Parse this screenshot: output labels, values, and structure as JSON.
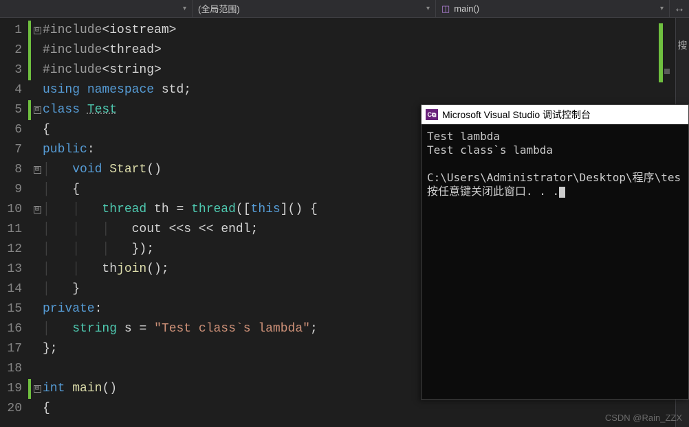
{
  "toolbar": {
    "dd1_label": "",
    "dd2_label": "(全局范围)",
    "dd3_label": "main()",
    "chevron": "▾",
    "split_icon": "↔"
  },
  "sidebar_text": "搜",
  "line_numbers": [
    "1",
    "2",
    "3",
    "4",
    "5",
    "6",
    "7",
    "8",
    "9",
    "10",
    "11",
    "12",
    "13",
    "14",
    "15",
    "16",
    "17",
    "18",
    "19",
    "20"
  ],
  "fold": {
    "l1": "⊟",
    "l5": "⊟",
    "l8": "⊟",
    "l10": "⊟",
    "l19": "⊟"
  },
  "code": {
    "l1": {
      "pp": "#include",
      "hdr": "<iostream>"
    },
    "l2": {
      "pp": "#include",
      "hdr": "<thread>"
    },
    "l3": {
      "pp": "#include",
      "hdr": "<string>"
    },
    "l4": {
      "kw1": "using",
      "kw2": "namespace",
      "id": "std",
      ";": ";"
    },
    "l5": {
      "kw": "class",
      "ty": "Test"
    },
    "l6": "{",
    "l7": {
      "kw": "public",
      ":": ":"
    },
    "l8": {
      "kw": "void",
      "fn": "Start",
      "()": "()"
    },
    "l9": "{",
    "l10": {
      "ty": "thread",
      "id": "th",
      "eq": "=",
      "ty2": "thread",
      "op": "([",
      "kw": "this",
      "cl": "]() {"
    },
    "l11": {
      "id": "cout",
      "op": "<<",
      "v": "s",
      "op2": "<<",
      "id2": "endl",
      ";": ";"
    },
    "l12": "});",
    "l13": {
      "id": "th",
      ".": ".",
      "fn": "join",
      "()": "();"
    },
    "l14": "}",
    "l15": {
      "kw": "private",
      ":": ":"
    },
    "l16": {
      "ty": "string",
      "id": "s",
      "eq": "=",
      "str": "\"Test class`s lambda\"",
      ";": ";"
    },
    "l17": "};",
    "l18": "",
    "l19": {
      "kw": "int",
      "fn": "main",
      "()": "()"
    },
    "l20": "{"
  },
  "console": {
    "icon_text": "C⧉",
    "title": "Microsoft Visual Studio 调试控制台",
    "out1": "Test lambda",
    "out2": "Test class`s lambda",
    "out3": "",
    "out4": "C:\\Users\\Administrator\\Desktop\\程序\\tes",
    "out5": "按任意键关闭此窗口. . ."
  },
  "watermark": "CSDN @Rain_ZZX"
}
